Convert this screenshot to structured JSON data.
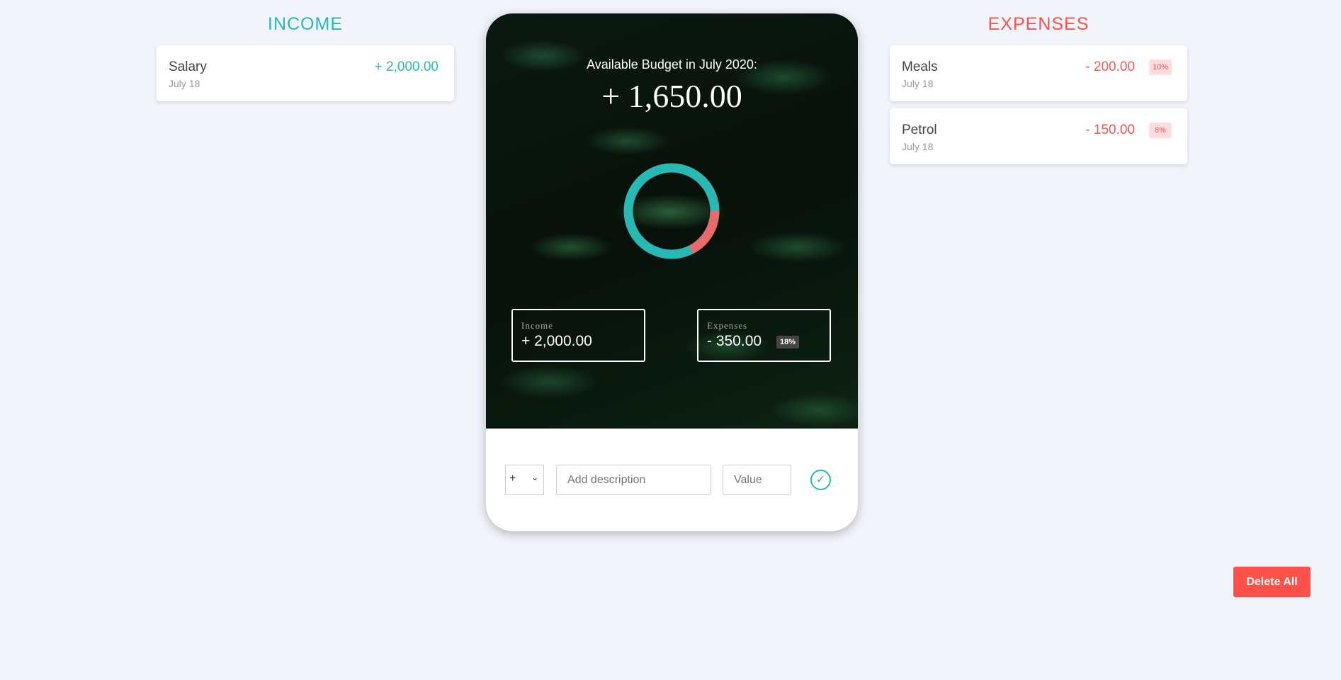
{
  "income": {
    "title": "INCOME",
    "items": [
      {
        "description": "Salary",
        "date": "July 18",
        "value": "+ 2,000.00"
      }
    ]
  },
  "expenses": {
    "title": "EXPENSES",
    "items": [
      {
        "description": "Meals",
        "date": "July 18",
        "value": "- 200.00",
        "percentage": "10%"
      },
      {
        "description": "Petrol",
        "date": "July 18",
        "value": "- 150.00",
        "percentage": "8%"
      }
    ]
  },
  "budget": {
    "label": "Available Budget in July 2020:",
    "value": "+ 1,650.00",
    "income_label": "Income",
    "income_value": "+ 2,000.00",
    "expenses_label": "Expenses",
    "expenses_value": "- 350.00",
    "expenses_percentage": "18%"
  },
  "chart_data": {
    "type": "pie",
    "categories": [
      "Income",
      "Expenses"
    ],
    "values": [
      2000,
      350
    ],
    "colors": [
      "#28b9b5",
      "#e86a6a"
    ]
  },
  "form": {
    "type_selected": "+",
    "description_placeholder": "Add description",
    "value_placeholder": "Value"
  },
  "delete_all_label": "Delete All",
  "colors": {
    "income": "#28b9b5",
    "expense": "#ff5049",
    "background": "#f1f4fb"
  }
}
